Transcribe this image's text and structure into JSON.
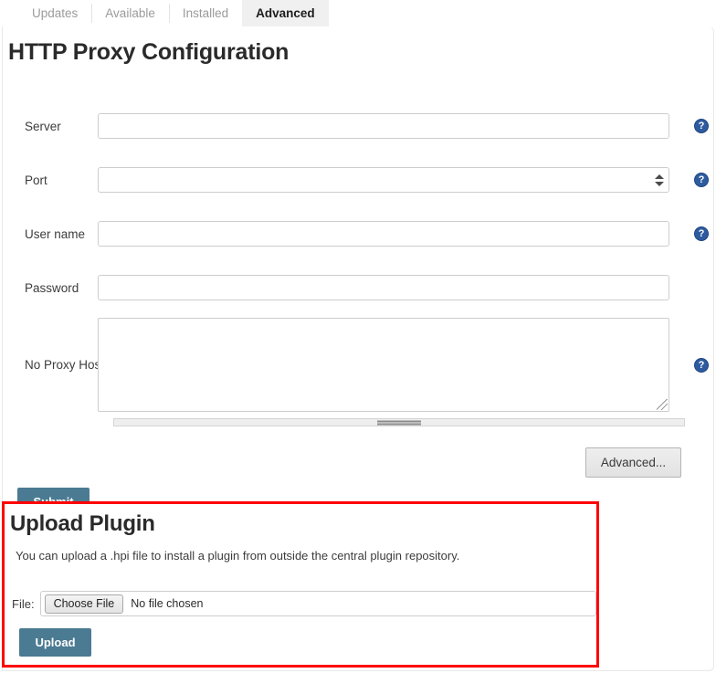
{
  "tabs": [
    {
      "label": "Updates",
      "active": false
    },
    {
      "label": "Available",
      "active": false
    },
    {
      "label": "Installed",
      "active": false
    },
    {
      "label": "Advanced",
      "active": true
    }
  ],
  "proxy": {
    "title": "HTTP Proxy Configuration",
    "fields": [
      {
        "label": "Server",
        "value": "",
        "placeholder": "",
        "help": "?"
      },
      {
        "label": "Port",
        "value": "",
        "placeholder": "",
        "help": "?"
      },
      {
        "label": "User name",
        "value": "",
        "placeholder": "",
        "help": "?"
      },
      {
        "label": "Password",
        "value": "",
        "placeholder": ""
      },
      {
        "label": "No Proxy Host",
        "value": "",
        "placeholder": "",
        "help": "?"
      }
    ],
    "advanced_label": "Advanced...",
    "submit_label": "Submit"
  },
  "upload": {
    "title": "Upload Plugin",
    "description": "You can upload a .hpi file to install a plugin from outside the central plugin repository.",
    "file_label": "File:",
    "choose_label": "Choose File",
    "file_status": "No file chosen",
    "upload_label": "Upload"
  },
  "colors": {
    "primary_button": "#4a7b92",
    "highlight_border": "#fe0000",
    "help_icon": "#2e5b9e",
    "active_tab_bg": "#f0f0f0"
  }
}
